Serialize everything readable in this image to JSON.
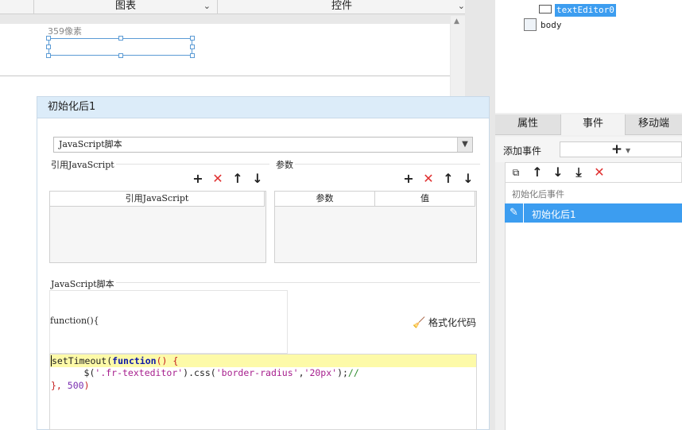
{
  "top_tabs": {
    "chart_label": "图表",
    "widget_label": "控件"
  },
  "canvas": {
    "size_label": "359像素"
  },
  "tree": {
    "selected_item": "textEditor0",
    "body_item": "body"
  },
  "right_tabs": [
    {
      "label": "属性"
    },
    {
      "label": "事件"
    },
    {
      "label": "移动端"
    }
  ],
  "events": {
    "add_label": "添加事件",
    "add_button": "+",
    "group_label": "初始化后事件",
    "selected_event": "初始化后1"
  },
  "dialog": {
    "title": "初始化后1",
    "script_type": "JavaScript脚本",
    "ref_section": "引用JavaScript",
    "param_section": "参数",
    "ref_column": "引用JavaScript",
    "param_columns": [
      "参数",
      "值"
    ],
    "script_section": "JavaScript脚本",
    "function_header": "function(){",
    "format_button": "格式化代码",
    "code": {
      "line1_a": "setTimeout(",
      "line1_kw": "function",
      "line1_b": "() {",
      "line2_indent": "      $(",
      "line2_str": "'.fr-texteditor'",
      "line2_b": ").css(",
      "line2_str2": "'border-radius'",
      "line2_c": ",",
      "line2_str3": "'20px'",
      "line2_d": ");",
      "line2_cmt": "//",
      "line3_a": "}, ",
      "line3_num": "500",
      "line3_b": ")"
    }
  },
  "colors": {
    "accent": "#3c9df0",
    "selection_border": "#5b9bd5",
    "highlight_line": "#fdfaa8",
    "delete_red": "#e03030"
  }
}
